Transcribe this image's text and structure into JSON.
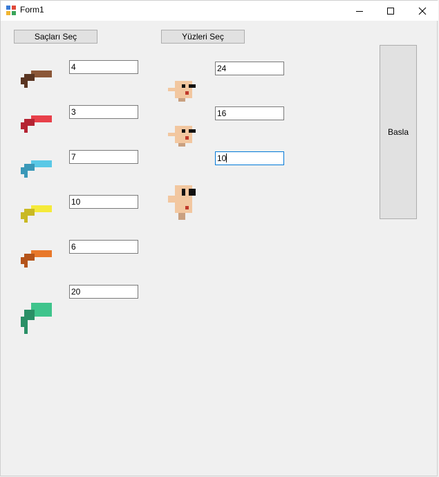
{
  "window": {
    "title": "Form1"
  },
  "buttons": {
    "hair_select": "Saçları Seç",
    "face_select": "Yüzleri Seç",
    "start": "Basla"
  },
  "hair": {
    "items": [
      {
        "value": "4",
        "color": "#8b5738",
        "dark": "#5a3522",
        "icon": "hair-sprite-brown"
      },
      {
        "value": "3",
        "color": "#e8404a",
        "dark": "#b52433",
        "icon": "hair-sprite-red"
      },
      {
        "value": "7",
        "color": "#5ac8e6",
        "dark": "#3a98b8",
        "icon": "hair-sprite-cyan"
      },
      {
        "value": "10",
        "color": "#f5ea3a",
        "dark": "#c9b924",
        "icon": "hair-sprite-yellow"
      },
      {
        "value": "6",
        "color": "#e8782a",
        "dark": "#b4541a",
        "icon": "hair-sprite-orange"
      },
      {
        "value": "20",
        "color": "#3fc48c",
        "dark": "#2a8f66",
        "icon": "hair-sprite-green"
      }
    ]
  },
  "faces": {
    "items": [
      {
        "value": "24",
        "icon": "face-sprite-1"
      },
      {
        "value": "16",
        "icon": "face-sprite-2"
      },
      {
        "value": "10",
        "icon": "face-sprite-3"
      }
    ]
  }
}
